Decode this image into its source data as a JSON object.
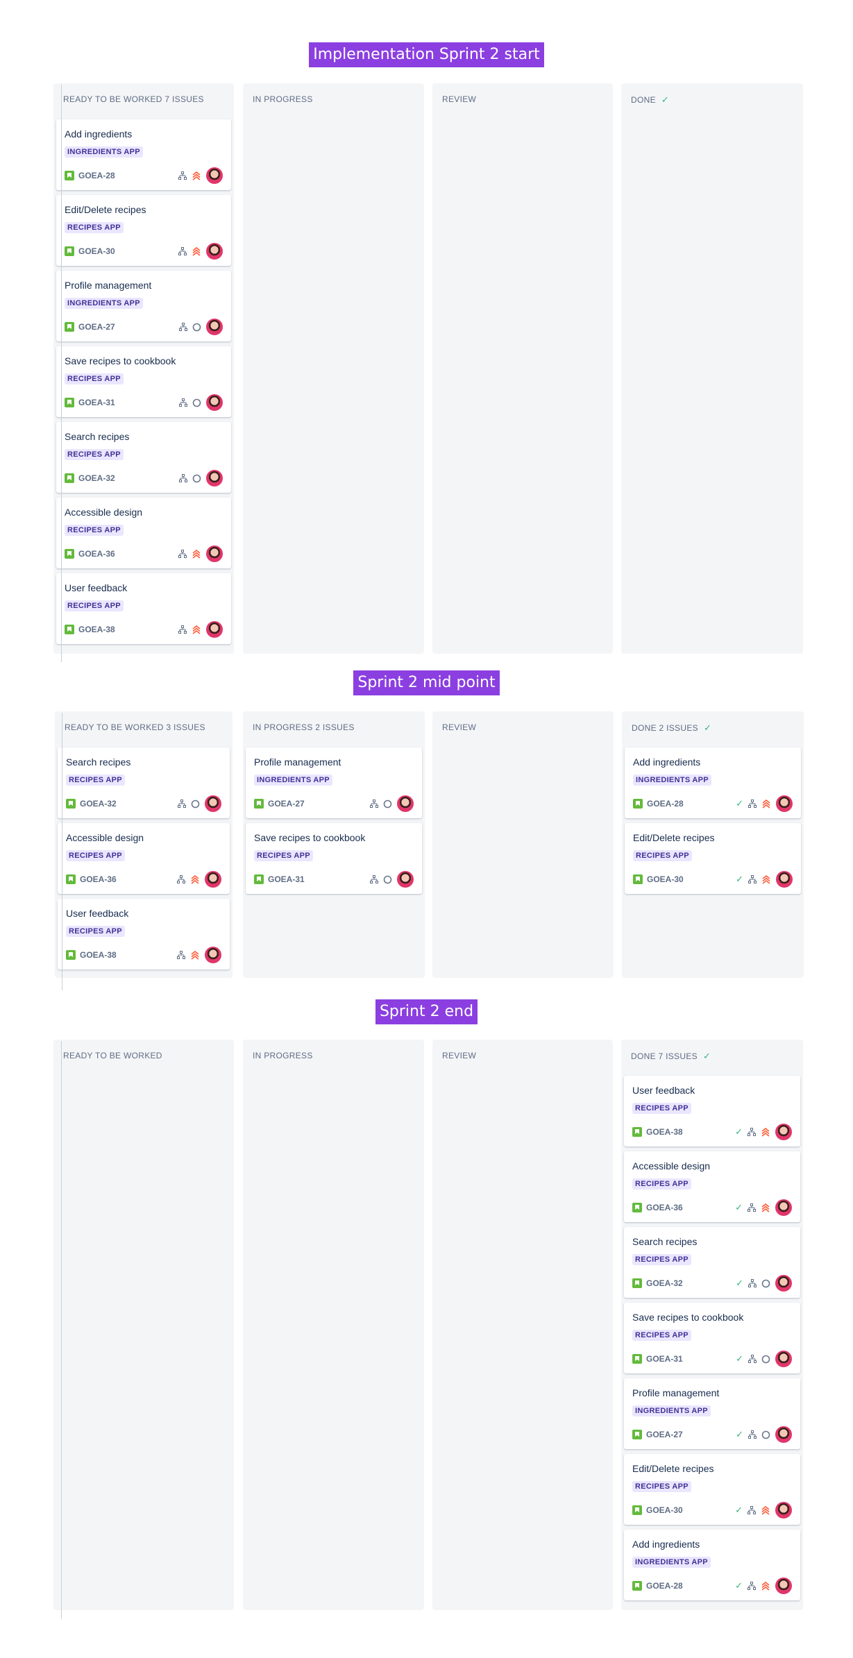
{
  "sections": [
    {
      "title": "Implementation Sprint 2 start",
      "columns": [
        {
          "header": "READY TO BE WORKED 7 ISSUES",
          "done": false,
          "cards": [
            {
              "title": "Add ingredients",
              "epic": "INGREDIENTS APP",
              "key": "GOEA-28",
              "priority": "high",
              "resolved": false
            },
            {
              "title": "Edit/Delete recipes",
              "epic": "RECIPES APP",
              "key": "GOEA-30",
              "priority": "high",
              "resolved": false
            },
            {
              "title": "Profile management",
              "epic": "INGREDIENTS APP",
              "key": "GOEA-27",
              "priority": "medium",
              "resolved": false
            },
            {
              "title": "Save recipes to cookbook",
              "epic": "RECIPES APP",
              "key": "GOEA-31",
              "priority": "medium",
              "resolved": false
            },
            {
              "title": "Search recipes",
              "epic": "RECIPES APP",
              "key": "GOEA-32",
              "priority": "medium",
              "resolved": false
            },
            {
              "title": "Accessible design",
              "epic": "RECIPES APP",
              "key": "GOEA-36",
              "priority": "high",
              "resolved": false
            },
            {
              "title": "User feedback",
              "epic": "RECIPES APP",
              "key": "GOEA-38",
              "priority": "high",
              "resolved": false
            }
          ]
        },
        {
          "header": "IN PROGRESS",
          "done": false,
          "cards": []
        },
        {
          "header": "REVIEW",
          "done": false,
          "cards": []
        },
        {
          "header": "DONE",
          "done": true,
          "cards": []
        }
      ]
    },
    {
      "title": "Sprint 2 mid point",
      "columns": [
        {
          "header": "READY TO BE WORKED 3 ISSUES",
          "done": false,
          "cards": [
            {
              "title": "Search recipes",
              "epic": "RECIPES APP",
              "key": "GOEA-32",
              "priority": "medium",
              "resolved": false
            },
            {
              "title": "Accessible design",
              "epic": "RECIPES APP",
              "key": "GOEA-36",
              "priority": "high",
              "resolved": false
            },
            {
              "title": "User feedback",
              "epic": "RECIPES APP",
              "key": "GOEA-38",
              "priority": "high",
              "resolved": false
            }
          ]
        },
        {
          "header": "IN PROGRESS 2 ISSUES",
          "done": false,
          "cards": [
            {
              "title": "Profile management",
              "epic": "INGREDIENTS APP",
              "key": "GOEA-27",
              "priority": "medium",
              "resolved": false
            },
            {
              "title": "Save recipes to cookbook",
              "epic": "RECIPES APP",
              "key": "GOEA-31",
              "priority": "medium",
              "resolved": false
            }
          ]
        },
        {
          "header": "REVIEW",
          "done": false,
          "cards": []
        },
        {
          "header": "DONE 2 ISSUES",
          "done": true,
          "cards": [
            {
              "title": "Add ingredients",
              "epic": "INGREDIENTS APP",
              "key": "GOEA-28",
              "priority": "high",
              "resolved": true
            },
            {
              "title": "Edit/Delete recipes",
              "epic": "RECIPES APP",
              "key": "GOEA-30",
              "priority": "high",
              "resolved": true
            }
          ]
        }
      ]
    },
    {
      "title": "Sprint 2 end",
      "columns": [
        {
          "header": "READY TO BE WORKED",
          "done": false,
          "cards": []
        },
        {
          "header": "IN PROGRESS",
          "done": false,
          "cards": []
        },
        {
          "header": "REVIEW",
          "done": false,
          "cards": []
        },
        {
          "header": "DONE 7 ISSUES",
          "done": true,
          "cards": [
            {
              "title": "User feedback",
              "epic": "RECIPES APP",
              "key": "GOEA-38",
              "priority": "high",
              "resolved": true
            },
            {
              "title": "Accessible design",
              "epic": "RECIPES APP",
              "key": "GOEA-36",
              "priority": "high",
              "resolved": true
            },
            {
              "title": "Search recipes",
              "epic": "RECIPES APP",
              "key": "GOEA-32",
              "priority": "medium",
              "resolved": true
            },
            {
              "title": "Save recipes to cookbook",
              "epic": "RECIPES APP",
              "key": "GOEA-31",
              "priority": "medium",
              "resolved": true
            },
            {
              "title": "Profile management",
              "epic": "INGREDIENTS APP",
              "key": "GOEA-27",
              "priority": "medium",
              "resolved": true
            },
            {
              "title": "Edit/Delete recipes",
              "epic": "RECIPES APP",
              "key": "GOEA-30",
              "priority": "high",
              "resolved": true
            },
            {
              "title": "Add ingredients",
              "epic": "INGREDIENTS APP",
              "key": "GOEA-28",
              "priority": "high",
              "resolved": true
            }
          ]
        }
      ]
    }
  ],
  "icons": {
    "issue_type": "story-icon",
    "subtasks": "subtask-tree-icon",
    "priority_high": "priority-highest-icon",
    "priority_medium": "priority-medium-icon",
    "resolved": "check-icon",
    "assignee": "avatar"
  },
  "colors": {
    "title_band": "#8b3fe0",
    "column_bg": "#f4f5f7",
    "epic_bg": "#eae6ff",
    "epic_text": "#403294",
    "story_green": "#63ba3c",
    "priority_orange": "#ff5630",
    "done_green": "#36b37e"
  }
}
